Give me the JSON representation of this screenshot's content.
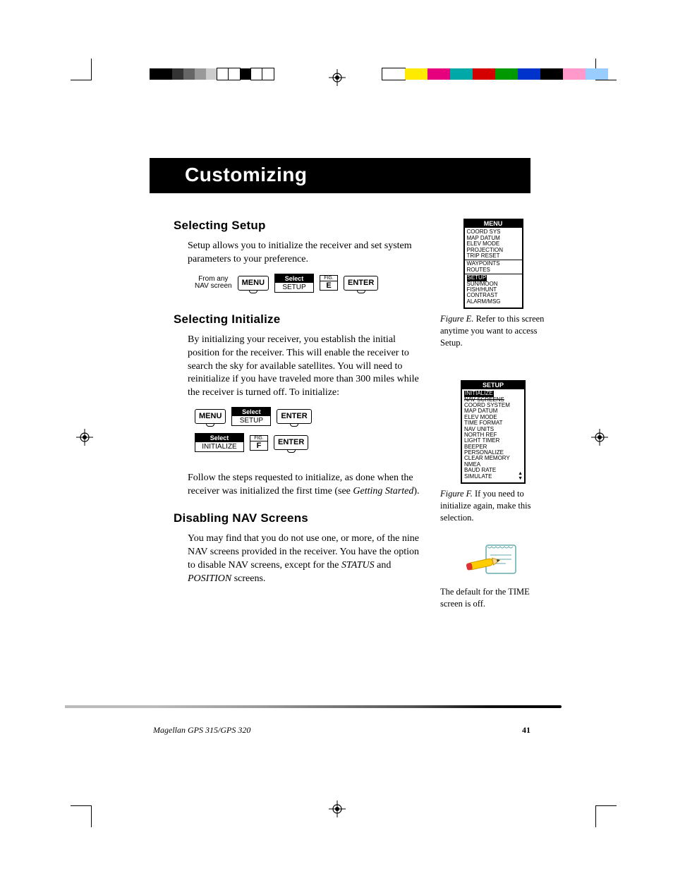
{
  "page_title": "Customizing",
  "sections": {
    "setup": {
      "heading": "Selecting Setup",
      "body": "Setup allows you to initialize the receiver and set system parameters to your preference.",
      "steps1": {
        "from": "From any\nNAV screen",
        "menu": "MENU",
        "select_label": "Select",
        "select_value": "SETUP",
        "fig_label": "FIG.",
        "fig_value": "E",
        "enter": "ENTER"
      }
    },
    "init": {
      "heading": "Selecting Initialize",
      "body1": "By initializing your receiver, you establish the initial position for the receiver.  This will enable the receiver to search the sky for available satellites.  You will need to reinitialize if you have traveled more than 300 miles while the receiver is turned off.  To initialize:",
      "row1": {
        "menu": "MENU",
        "select_label": "Select",
        "select_value": "SETUP",
        "enter": "ENTER"
      },
      "row2": {
        "select_label": "Select",
        "select_value": "INITIALIZE",
        "fig_label": "FIG.",
        "fig_value": "F",
        "enter": "ENTER"
      },
      "body2_a": "Follow the steps requested to initialize, as done when the receiver was initialized the first time (see ",
      "body2_i": "Getting Started",
      "body2_b": ")."
    },
    "nav": {
      "heading": "Disabling NAV Screens",
      "body_a": "You may find that you do not use one, or more, of the nine NAV screens provided in the receiver.  You have the option to disable NAV screens, except for the ",
      "body_i1": "STATUS",
      "body_m": " and ",
      "body_i2": "POSITION",
      "body_b": " screens."
    }
  },
  "sidebar": {
    "figE": {
      "title": "MENU",
      "items_top": [
        "COORD SYS",
        "MAP DATUM",
        "ELEV MODE",
        "PROJECTION",
        "TRIP RESET"
      ],
      "items_mid": [
        "WAYPOINTS",
        "ROUTES"
      ],
      "highlight": "SETUP",
      "items_bot": [
        "SUN/MOON",
        "FISH/HUNT",
        "CONTRAST",
        "ALARM/MSG"
      ],
      "caption_label": "Figure E.",
      "caption": "  Refer to this screen anytime you want to access Setup."
    },
    "figF": {
      "title": "SETUP",
      "highlight": "INITIALIZE",
      "strike": "NAV SCREENS",
      "items": [
        "COORD SYSTEM",
        "MAP DATUM",
        "ELEV MODE",
        "TIME FORMAT",
        "NAV UNITS",
        "NORTH REF",
        "LIGHT TIMER",
        "BEEPER",
        "PERSONALIZE",
        "CLEAR MEMORY",
        "NMEA",
        "BAUD RATE",
        "SIMULATE"
      ],
      "caption_label": "Figure F.",
      "caption": "  If you need to initialize again, make this selection."
    },
    "note": "The default for the TIME screen is off."
  },
  "footer": {
    "model": "Magellan GPS 315/GPS 320",
    "page": "41"
  },
  "colors": {
    "bar_left": [
      "#000",
      "#000",
      "#333",
      "#666",
      "#999",
      "#ccc",
      "#fff",
      "#fff",
      "#000",
      "#fff",
      "#fff"
    ],
    "bar_right": [
      "#fff",
      "#ffea00",
      "#e6007e",
      "#00a8a8",
      "#d40000",
      "#009900",
      "#0033cc",
      "#000",
      "#f9c",
      "#9cf"
    ]
  }
}
